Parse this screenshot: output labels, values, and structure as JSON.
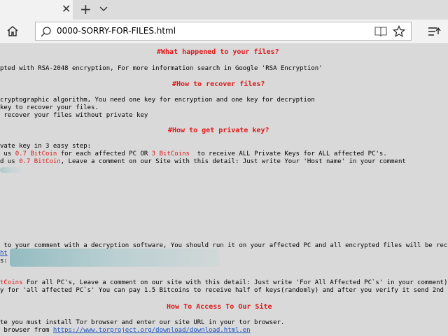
{
  "browser": {
    "tab_close": "✕",
    "new_tab": "+",
    "address": "0000-SORRY-FOR-FILES.html"
  },
  "page": {
    "h1": "#What happened to your files?",
    "l1": "pted with RSA-2048 encryption, For more information search in Google 'RSA Encryption'",
    "h2": "#How to recover files?",
    "l2a": "cryptographic algorithm, You need one key for encryption and one key for decryption",
    "l2b": "key to recover your files.",
    "l2c": " recover your files without private key",
    "h3": "#How to get private key?",
    "l3a": "vate key in 3 easy step:",
    "l3b_pre": " us ",
    "l3b_r1": "0.7 BitCoin",
    "l3b_mid": " for each affected PC OR ",
    "l3b_r2": "3 BitCoins",
    "l3b_post": "  to receive ALL Private Keys for ALL affected PC's.",
    "l3c_pre": "d us ",
    "l3c_r": "0.7 BitCoin",
    "l3c_post": ", Leave a comment on our Site with this detail: Just write Your 'Host name' in your comment",
    "l4a": " to your comment with a decryption software, You should run it on your affected PC and all encrypted files will be recovered",
    "l4b": "ht",
    "l4c": "s:",
    "l5a_r": "tCoins",
    "l5a_post": " For all PC's, Leave a comment on our site with this detail: Just write 'For All Affected PC`s' in your comment)",
    "l5b": "y for 'all affected PC`s' You can pay 1.5 Bitcoins to receive half of keys(randomly) and after you verify it send 2nd half to",
    "h4": "How To Access To Our Site",
    "l6a": "te you must install Tor browser and enter our site URL in your tor browser.",
    "l6b_pre": " browser from ",
    "l6b_link": "https://www.torproject.org/download/download.html.en"
  }
}
